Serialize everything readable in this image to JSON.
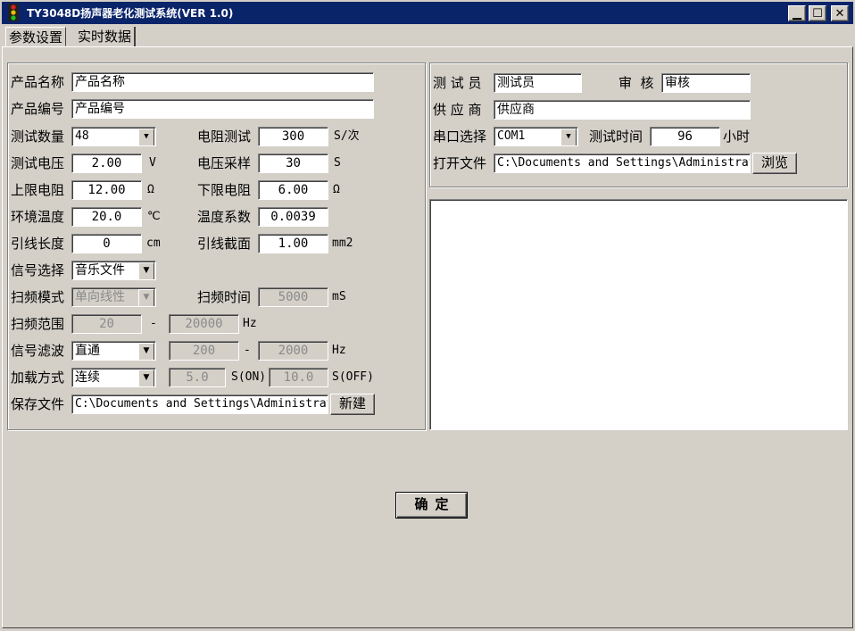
{
  "window": {
    "title": "TY3048D扬声器老化测试系统(VER 1.0)"
  },
  "tabs": [
    "参数设置",
    "实时数据"
  ],
  "left": {
    "product_name_label": "产品名称",
    "product_name": "产品名称",
    "product_code_label": "产品编号",
    "product_code": "产品编号",
    "test_count_label": "测试数量",
    "test_count": "48",
    "res_test_label": "电阻测试",
    "res_test": "300",
    "res_test_unit": "S/次",
    "test_voltage_label": "测试电压",
    "test_voltage": "2.00",
    "test_voltage_unit": "V",
    "volt_sample_label": "电压采样",
    "volt_sample": "30",
    "volt_sample_unit": "S",
    "upper_res_label": "上限电阻",
    "upper_res": "12.00",
    "upper_res_unit": "Ω",
    "lower_res_label": "下限电阻",
    "lower_res": "6.00",
    "lower_res_unit": "Ω",
    "env_temp_label": "环境温度",
    "env_temp": "20.0",
    "env_temp_unit": "℃",
    "temp_coef_label": "温度系数",
    "temp_coef": "0.0039",
    "lead_len_label": "引线长度",
    "lead_len": "0",
    "lead_len_unit": "cm",
    "lead_area_label": "引线截面",
    "lead_area": "1.00",
    "lead_area_unit": "mm2",
    "signal_label": "信号选择",
    "signal": "音乐文件",
    "sweep_mode_label": "扫频模式",
    "sweep_mode": "单向线性",
    "sweep_time_label": "扫频时间",
    "sweep_time": "5000",
    "sweep_time_unit": "mS",
    "sweep_range_label": "扫频范围",
    "sweep_from": "20",
    "sweep_dash": "-",
    "sweep_to": "20000",
    "sweep_unit": "Hz",
    "filter_label": "信号滤波",
    "filter": "直通",
    "filter_from": "200",
    "filter_dash": "-",
    "filter_to": "2000",
    "filter_unit": "Hz",
    "load_label": "加载方式",
    "load": "连续",
    "on_time": "5.0",
    "on_unit": "S(ON)",
    "off_time": "10.0",
    "off_unit": "S(OFF)",
    "save_file_label": "保存文件",
    "save_file": "C:\\Documents and Settings\\Administrator",
    "new_btn": "新建"
  },
  "right": {
    "tester_label": "测 试 员",
    "tester": "测试员",
    "reviewer_label": "审  核",
    "reviewer": "审核",
    "supplier_label": "供 应 商",
    "supplier": "供应商",
    "port_label": "串口选择",
    "port": "COM1",
    "test_time_label": "测试时间",
    "test_time": "96",
    "test_time_unit": "小时",
    "open_file_label": "打开文件",
    "open_file": "C:\\Documents and Settings\\Administrator",
    "browse_btn": "浏览"
  },
  "ok_button": "确定"
}
